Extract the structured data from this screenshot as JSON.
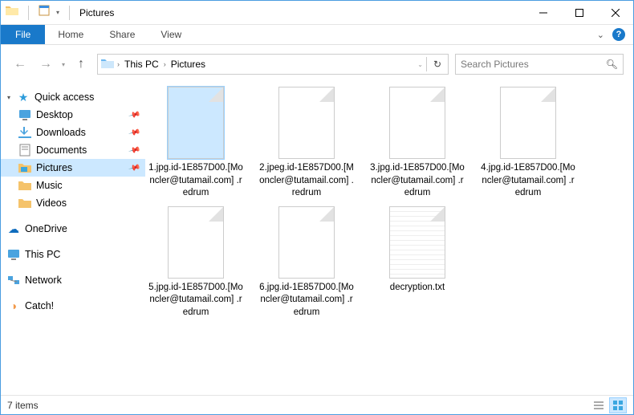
{
  "title": "Pictures",
  "ribbon": {
    "file": "File",
    "tabs": [
      "Home",
      "Share",
      "View"
    ]
  },
  "breadcrumb": [
    "This PC",
    "Pictures"
  ],
  "search_placeholder": "Search Pictures",
  "sidebar": {
    "quick_access": "Quick access",
    "items": [
      {
        "label": "Desktop",
        "pinned": true
      },
      {
        "label": "Downloads",
        "pinned": true
      },
      {
        "label": "Documents",
        "pinned": true
      },
      {
        "label": "Pictures",
        "pinned": true,
        "selected": true
      },
      {
        "label": "Music",
        "pinned": false
      },
      {
        "label": "Videos",
        "pinned": false
      }
    ],
    "onedrive": "OneDrive",
    "this_pc": "This PC",
    "network": "Network",
    "catch": "Catch!"
  },
  "files": [
    {
      "name": "1.jpg.id-1E857D00.[Moncler@tutamail.com] .redrum",
      "selected": true,
      "type": "blank"
    },
    {
      "name": "2.jpeg.id-1E857D00.[Moncler@tutamail.com] .redrum",
      "type": "blank"
    },
    {
      "name": "3.jpg.id-1E857D00.[Moncler@tutamail.com] .redrum",
      "type": "blank"
    },
    {
      "name": "4.jpg.id-1E857D00.[Moncler@tutamail.com] .redrum",
      "type": "blank"
    },
    {
      "name": "5.jpg.id-1E857D00.[Moncler@tutamail.com] .redrum",
      "type": "blank"
    },
    {
      "name": "6.jpg.id-1E857D00.[Moncler@tutamail.com] .redrum",
      "type": "blank"
    },
    {
      "name": "decryption.txt",
      "type": "txt"
    }
  ],
  "status": "7 items"
}
